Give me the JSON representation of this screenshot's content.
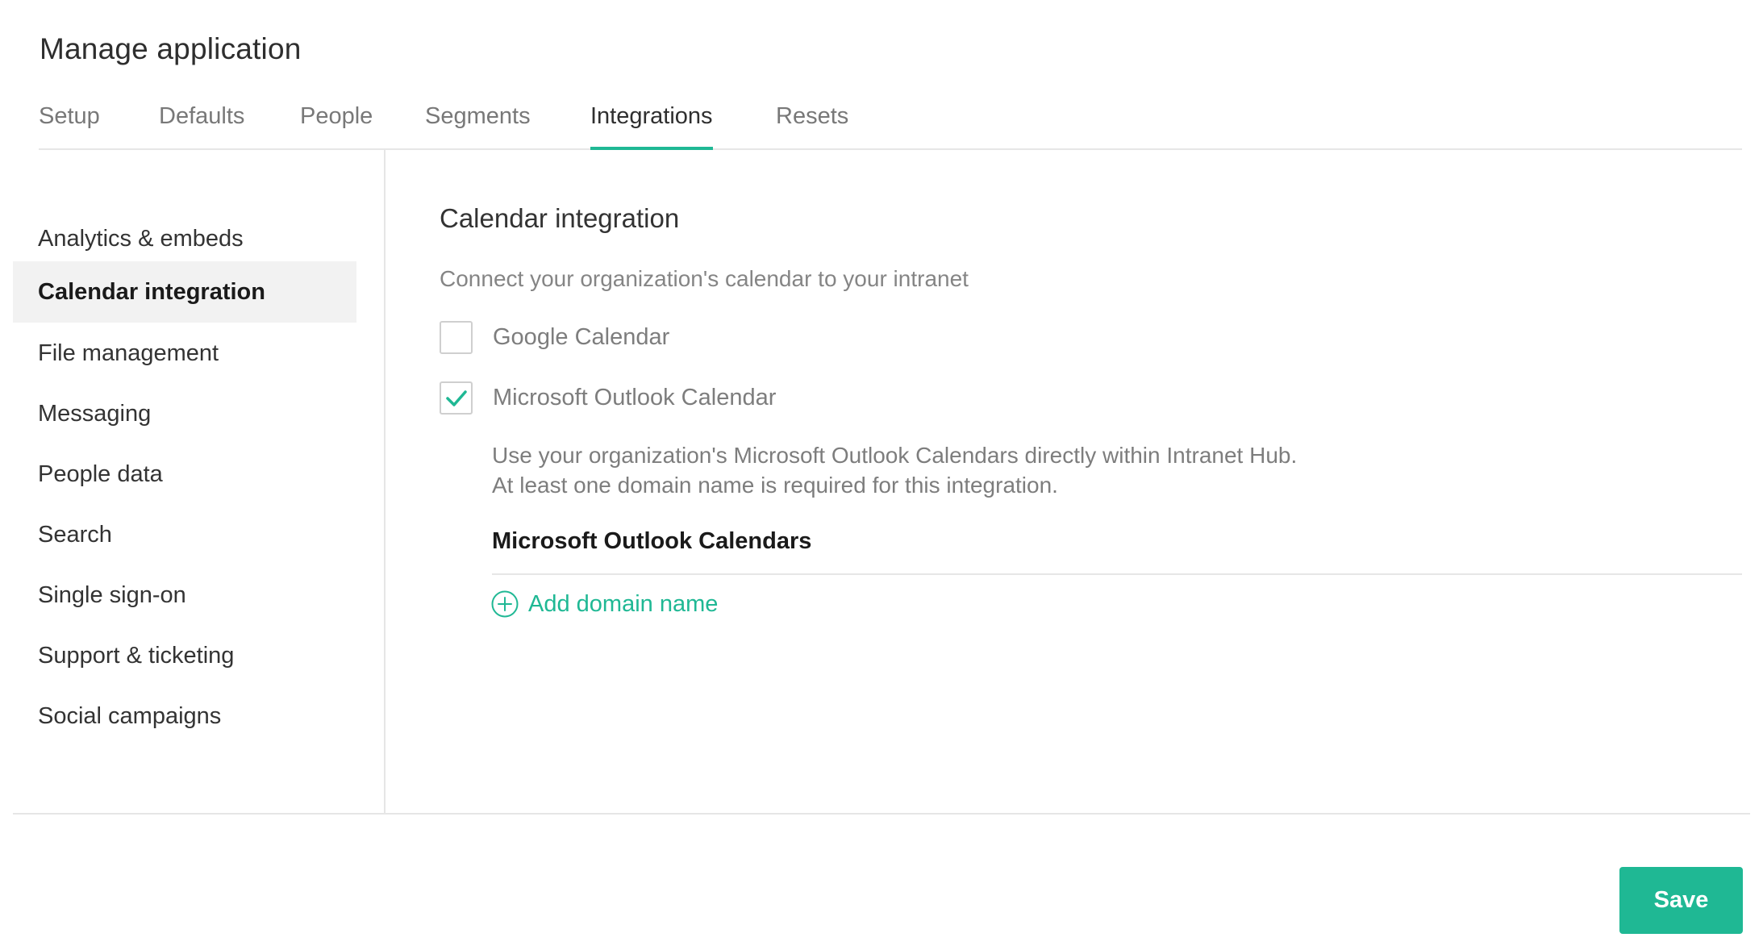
{
  "header": {
    "title": "Manage application"
  },
  "tabs": [
    {
      "label": "Setup"
    },
    {
      "label": "Defaults"
    },
    {
      "label": "People"
    },
    {
      "label": "Segments"
    },
    {
      "label": "Integrations"
    },
    {
      "label": "Resets"
    }
  ],
  "active_tab": "Integrations",
  "sidebar": {
    "items": [
      {
        "label": "Analytics & embeds"
      },
      {
        "label": "Calendar integration"
      },
      {
        "label": "File management"
      },
      {
        "label": "Messaging"
      },
      {
        "label": "People data"
      },
      {
        "label": "Search"
      },
      {
        "label": "Single sign-on"
      },
      {
        "label": "Support & ticketing"
      },
      {
        "label": "Social campaigns"
      }
    ],
    "active_item": "Calendar integration"
  },
  "main": {
    "title": "Calendar integration",
    "description": "Connect your organization's calendar to your intranet",
    "options": [
      {
        "label": "Google Calendar",
        "checked": false
      },
      {
        "label": "Microsoft Outlook Calendar",
        "checked": true
      }
    ],
    "outlook": {
      "description_line1": "Use your organization's Microsoft Outlook Calendars directly within Intranet Hub.",
      "description_line2": "At least one domain name is required for this integration.",
      "heading": "Microsoft Outlook Calendars",
      "add_domain_label": "Add domain name",
      "add_icon": "plus-circle-icon"
    }
  },
  "footer": {
    "save_label": "Save"
  },
  "colors": {
    "accent": "#1fb894",
    "active_sidebar_bg": "#f2f2f2",
    "divider": "#e6e6e6"
  }
}
